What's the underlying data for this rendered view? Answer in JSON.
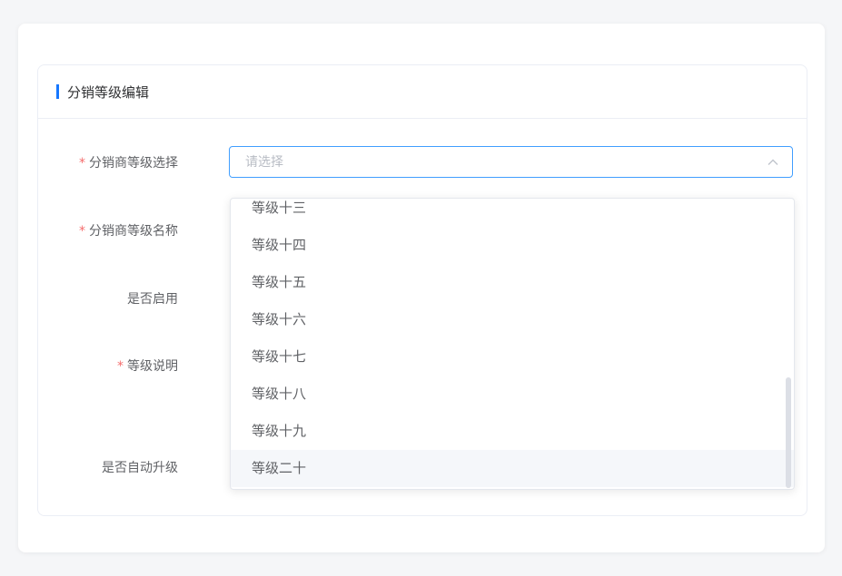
{
  "section": {
    "title": "分销等级编辑"
  },
  "form": {
    "level_select": {
      "label": "分销商等级选择",
      "required": "*",
      "placeholder": "请选择"
    },
    "level_name": {
      "label": "分销商等级名称",
      "required": "*"
    },
    "enabled": {
      "label": "是否启用"
    },
    "description": {
      "label": "等级说明",
      "required": "*"
    },
    "auto_upgrade": {
      "label": "是否自动升级"
    }
  },
  "dropdown": {
    "options": [
      "等级十三",
      "等级十四",
      "等级十五",
      "等级十六",
      "等级十七",
      "等级十八",
      "等级十九",
      "等级二十"
    ],
    "hovered": "等级二十"
  },
  "icons": {
    "select_toggle": "chevron-up-icon"
  },
  "colors": {
    "accent": "#1677ff",
    "required": "#f56c6c",
    "focus_border": "#409eff"
  }
}
